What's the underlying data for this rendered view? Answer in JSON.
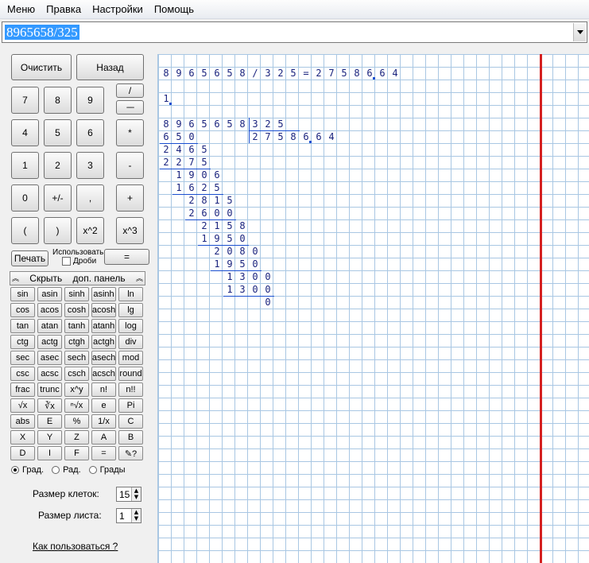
{
  "menu": [
    "Меню",
    "Правка",
    "Настройки",
    "Помощь"
  ],
  "expression": "8965658/325",
  "buttons": {
    "clear": "Очистить",
    "back": "Назад",
    "seven": "7",
    "eight": "8",
    "nine": "9",
    "div_top": "/",
    "div_bottom": "----",
    "four": "4",
    "five": "5",
    "six": "6",
    "mul": "*",
    "one": "1",
    "two": "2",
    "three": "3",
    "minus": "-",
    "zero": "0",
    "sign": "+/-",
    "comma": ",",
    "plus": "+",
    "lparen": "(",
    "rparen": ")",
    "square": "x^2",
    "cube": "x^3",
    "print": "Печать",
    "equals": "="
  },
  "use_fractions": {
    "line1": "Использовать",
    "line2": "Дроби"
  },
  "panel_toggle": {
    "hide": "Скрыть",
    "label": "доп. панель"
  },
  "functions": [
    [
      "sin",
      "asin",
      "sinh",
      "asinh",
      "ln"
    ],
    [
      "cos",
      "acos",
      "cosh",
      "acosh",
      "lg"
    ],
    [
      "tan",
      "atan",
      "tanh",
      "atanh",
      "log"
    ],
    [
      "ctg",
      "actg",
      "ctgh",
      "actgh",
      "div"
    ],
    [
      "sec",
      "asec",
      "sech",
      "asech",
      "mod"
    ],
    [
      "csc",
      "acsc",
      "csch",
      "acsch",
      "round"
    ],
    [
      "frac",
      "trunc",
      "x^y",
      "n!",
      "n!!"
    ],
    [
      "√x",
      "∛x",
      "ⁿ√x",
      "e",
      "Pi"
    ],
    [
      "abs",
      "E",
      "%",
      "1/x",
      "C"
    ],
    [
      "X",
      "Y",
      "Z",
      "A",
      "B"
    ],
    [
      "D",
      "I",
      "F",
      "=",
      "✎?"
    ]
  ],
  "angle_units": {
    "selected": "Град.",
    "options": [
      "Град.",
      "Рад.",
      "Грады"
    ]
  },
  "cell_size": {
    "label": "Размер клеток:",
    "value": "15"
  },
  "sheet_size": {
    "label": "Размер листа:",
    "value": "1"
  },
  "help_link": "Как пользоваться ?",
  "sheet": {
    "header": [
      "8",
      "9",
      "6",
      "5",
      "6",
      "5",
      "8",
      "/",
      "3",
      "2",
      "5",
      "=",
      "2",
      "7",
      "5",
      "8",
      "6",
      "6",
      "4"
    ],
    "step_number": "1",
    "dividend": [
      "8",
      "9",
      "6",
      "5",
      "6",
      "5",
      "8"
    ],
    "divisor": [
      "3",
      "2",
      "5"
    ],
    "quotient": [
      "2",
      "7",
      "5",
      "8",
      "6",
      "6",
      "4"
    ],
    "steps": [
      {
        "digits": [
          "6",
          "5",
          "0"
        ],
        "col": 0
      },
      {
        "digits": [
          "2",
          "4",
          "6",
          "5"
        ],
        "col": 0
      },
      {
        "digits": [
          "2",
          "2",
          "7",
          "5"
        ],
        "col": 0
      },
      {
        "digits": [
          "1",
          "9",
          "0",
          "6"
        ],
        "col": 1
      },
      {
        "digits": [
          "1",
          "6",
          "2",
          "5"
        ],
        "col": 1
      },
      {
        "digits": [
          "2",
          "8",
          "1",
          "5"
        ],
        "col": 2
      },
      {
        "digits": [
          "2",
          "6",
          "0",
          "0"
        ],
        "col": 2
      },
      {
        "digits": [
          "2",
          "1",
          "5",
          "8"
        ],
        "col": 3
      },
      {
        "digits": [
          "1",
          "9",
          "5",
          "0"
        ],
        "col": 3
      },
      {
        "digits": [
          "2",
          "0",
          "8",
          "0"
        ],
        "col": 4
      },
      {
        "digits": [
          "1",
          "9",
          "5",
          "0"
        ],
        "col": 4
      },
      {
        "digits": [
          "1",
          "3",
          "0",
          "0"
        ],
        "col": 5
      },
      {
        "digits": [
          "1",
          "3",
          "0",
          "0"
        ],
        "col": 5
      },
      {
        "digits": [
          "0"
        ],
        "col": 8
      }
    ]
  }
}
